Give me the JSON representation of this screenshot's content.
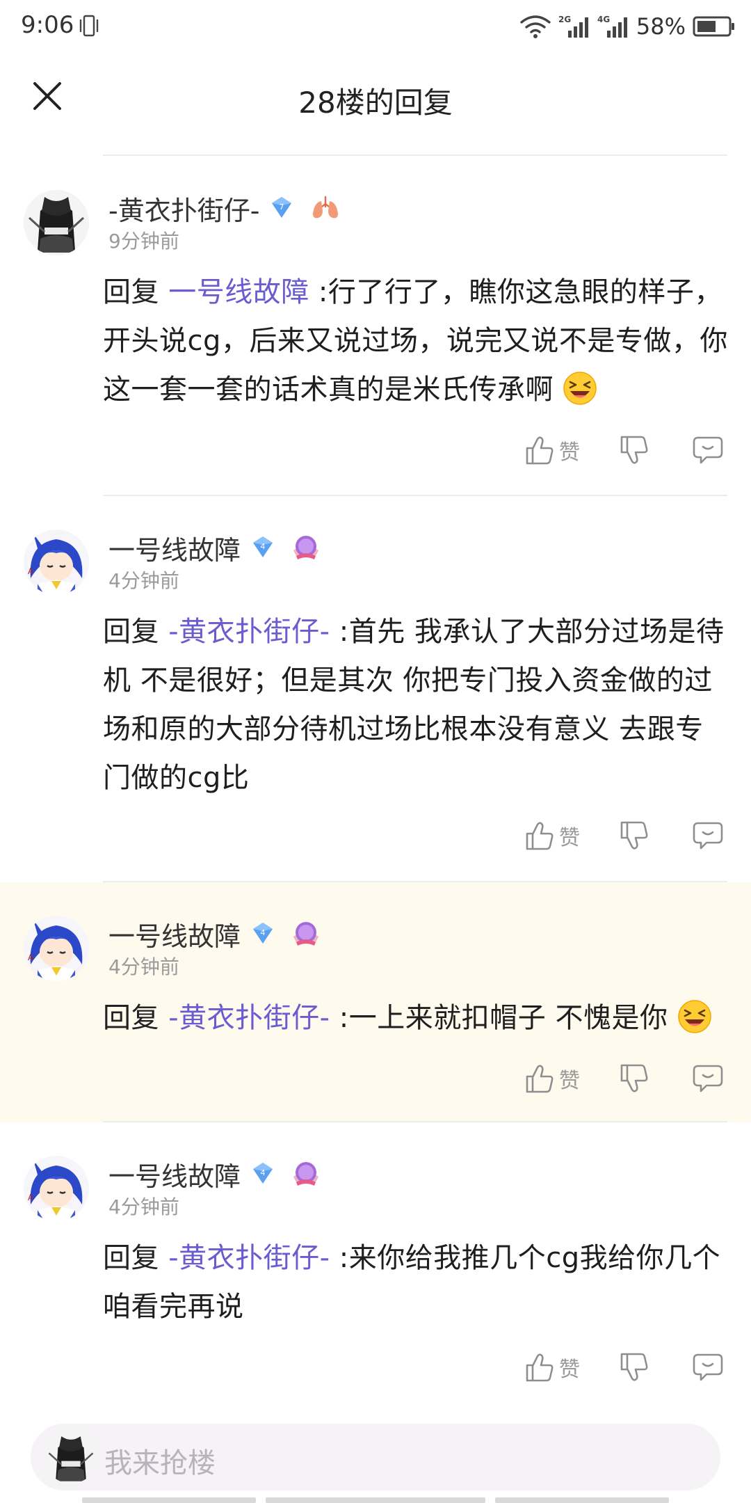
{
  "status_bar": {
    "time": "9:06",
    "battery": "58%",
    "icons": [
      "vibrate-icon",
      "wifi-icon",
      "2g-signal-icon",
      "4g-signal-icon",
      "battery-icon"
    ]
  },
  "header": {
    "title": "28楼的回复",
    "close_icon": "close-icon"
  },
  "comments": [
    {
      "username": "-黄衣扑街仔-",
      "time": "9分钟前",
      "level": "7",
      "reply_prefix": "回复 ",
      "mention": "一号线故障",
      "mention_highlight": true,
      "text": " :行了行了，瞧你这急眼的样子，开头说cg，后来又说过场，说完又说不是专做，你这一套一套的话术真的是米氏传承啊",
      "emoji": "grinning-squint-emoji",
      "like_label": "赞"
    },
    {
      "username": "一号线故障",
      "time": "4分钟前",
      "level": "4",
      "reply_prefix": "回复 ",
      "mention": "-黄衣扑街仔-",
      "text": " :首先 我承认了大部分过场是待机 不是很好；但是其次 你把专门投入资金做的过场和原的大部分待机过场比根本没有意义 去跟专门做的cg比",
      "like_label": "赞"
    },
    {
      "username": "一号线故障",
      "time": "4分钟前",
      "level": "4",
      "reply_prefix": "回复 ",
      "mention": "-黄衣扑街仔-",
      "text": " :一上来就扣帽子 不愧是你",
      "emoji": "grinning-squint-emoji",
      "like_label": "赞"
    },
    {
      "username": "一号线故障",
      "time": "4分钟前",
      "level": "4",
      "reply_prefix": "回复 ",
      "mention": "-黄衣扑街仔-",
      "text": " :来你给我推几个cg我给你几个 咱看完再说",
      "like_label": "赞"
    }
  ],
  "input": {
    "placeholder": "我来抢楼"
  },
  "colors": {
    "mention": "#6b5bd0",
    "highlight_bg": "#fffaee",
    "timestamp": "#9a9a9a",
    "badge_blue": "#5aa0f0"
  }
}
